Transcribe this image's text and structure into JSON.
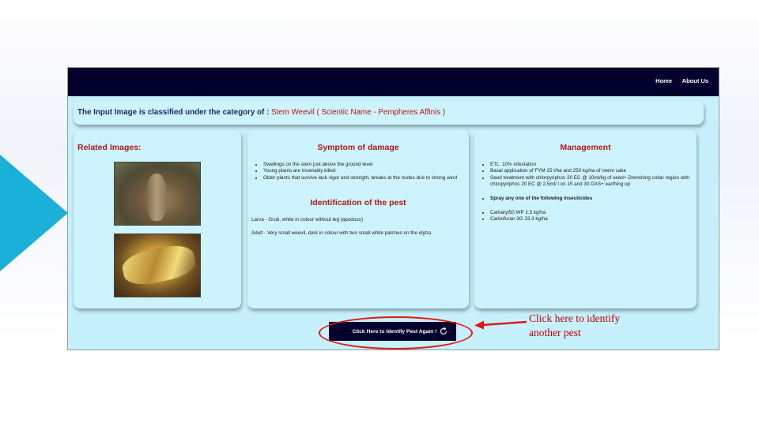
{
  "nav": {
    "home_label": "Home",
    "about_label": "About Us"
  },
  "classification": {
    "prefix": "The Input Image is classified under the category of :",
    "result": "Stem Weevil ( Scientic Name - Pempheres Affinis )"
  },
  "related": {
    "title": "Related Images:"
  },
  "symptom": {
    "title": "Symptom of damage",
    "items": [
      "Swellings on the stem just above the ground level",
      "Young plants are invariably killed",
      "Older plants that survive lack vigor and strength, breaks at the nodes due to strong wind"
    ],
    "identification_title": "Identification of the pest",
    "larva": "Larva - Grub, white in colour without leg (apodous)",
    "adult": "Adult - Very small weevil, dark in colour with two small white patches on the elytra"
  },
  "management": {
    "title": "Management",
    "items": [
      "ETL: 10% infestation",
      "Basal application of FYM 25 t/ha and 250 kg/ha of neem cake",
      "Seed treatment with chlorpyriphos 20 EC @ 10ml/kg of seed+ Drenching collar region with chlorpyriphos 20 EC @ 2.5ml/ l on 15 and 30 DAS+ earthing up"
    ],
    "spray_label": "Spray any one of the following insecticides",
    "insecticides": [
      "Carbaryl50 WP 2.5 kg/ha",
      "Carbofuran 3G 33.3 kg/ha"
    ]
  },
  "action": {
    "button_label": "Click Here to Identify Pest Again !"
  },
  "annotation": {
    "text": "Click here to identify\nanother pest",
    "color": "#c00000"
  },
  "colors": {
    "navbar": "#02002d",
    "accent_red": "#b01818",
    "page_bg": "#c6f0fb",
    "slide_arrow": "#1ab0d8"
  }
}
